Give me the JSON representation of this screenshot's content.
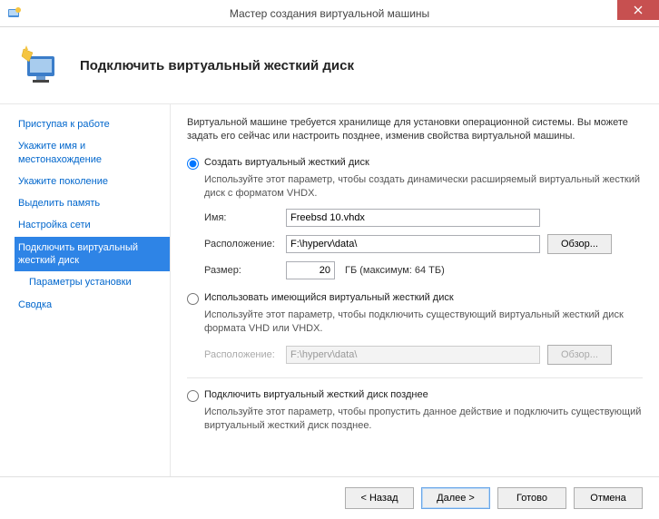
{
  "titlebar": {
    "title": "Мастер создания виртуальной машины"
  },
  "header": {
    "title": "Подключить виртуальный жесткий диск"
  },
  "sidebar": {
    "items": [
      {
        "label": "Приступая к работе"
      },
      {
        "label": "Укажите имя и местонахождение"
      },
      {
        "label": "Укажите поколение"
      },
      {
        "label": "Выделить память"
      },
      {
        "label": "Настройка сети"
      },
      {
        "label": "Подключить виртуальный жесткий диск"
      },
      {
        "label": "Параметры установки"
      },
      {
        "label": "Сводка"
      }
    ]
  },
  "main": {
    "intro": "Виртуальной машине требуется хранилище для установки операционной системы. Вы можете задать его сейчас или настроить позднее, изменив свойства виртуальной машины.",
    "option1": {
      "label": "Создать виртуальный жесткий диск",
      "desc": "Используйте этот параметр, чтобы создать динамически расширяемый виртуальный жесткий диск с форматом VHDX.",
      "name_label": "Имя:",
      "name_value": "Freebsd 10.vhdx",
      "loc_label": "Расположение:",
      "loc_value": "F:\\hyperv\\data\\",
      "browse_label": "Обзор...",
      "size_label": "Размер:",
      "size_value": "20",
      "size_unit": "ГБ (максимум: 64 ТБ)"
    },
    "option2": {
      "label": "Использовать имеющийся виртуальный жесткий диск",
      "desc": "Используйте этот параметр, чтобы подключить существующий виртуальный жесткий диск формата VHD или VHDX.",
      "loc_label": "Расположение:",
      "loc_value": "F:\\hyperv\\data\\",
      "browse_label": "Обзор..."
    },
    "option3": {
      "label": "Подключить виртуальный жесткий диск позднее",
      "desc": "Используйте этот параметр, чтобы пропустить данное действие и подключить существующий виртуальный жесткий диск позднее."
    }
  },
  "footer": {
    "back": "< Назад",
    "next": "Далее >",
    "finish": "Готово",
    "cancel": "Отмена"
  }
}
